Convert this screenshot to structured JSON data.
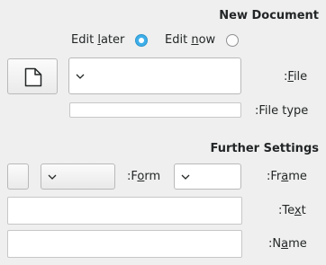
{
  "new_document": {
    "heading": "New Document",
    "edit_later": {
      "prefix": "Edit ",
      "key": "l",
      "suffix": "ater",
      "selected": true
    },
    "edit_now": {
      "prefix": "Edit ",
      "key": "n",
      "suffix": "ow",
      "selected": false
    },
    "new_file_icon": "blank-document-icon",
    "file_label": {
      "prefix": ":",
      "key": "F",
      "suffix": "ile"
    },
    "file_value": "",
    "file_type_label": ":File type",
    "file_type_value": ""
  },
  "further_settings": {
    "heading": "Further Settings",
    "form_label": {
      "prefix": ":F",
      "key": "o",
      "suffix": "rm"
    },
    "form_value": "",
    "frame_label": {
      "prefix": ":Fr",
      "key": "a",
      "suffix": "me"
    },
    "frame_value": "",
    "text_label": {
      "prefix": ":Te",
      "key": "x",
      "suffix": "t"
    },
    "text_value": "",
    "name_label": {
      "prefix": ":N",
      "key": "a",
      "suffix": "me"
    },
    "name_value": ""
  },
  "colors": {
    "accent": "#3daee9",
    "window_bg": "#efefef",
    "text": "#232627"
  }
}
